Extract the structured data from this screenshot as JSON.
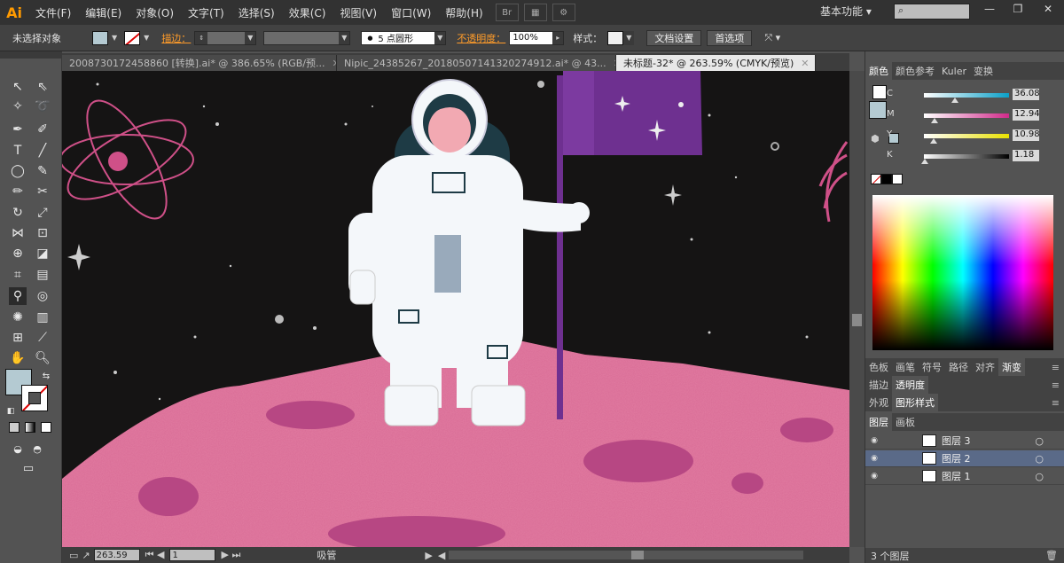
{
  "app": {
    "logo": "Ai"
  },
  "menu": [
    "文件(F)",
    "编辑(E)",
    "对象(O)",
    "文字(T)",
    "选择(S)",
    "效果(C)",
    "视图(V)",
    "窗口(W)",
    "帮助(H)"
  ],
  "menubar_icons": {
    "bridge": "Br",
    "arrange": "▦",
    "gpu": "⚙"
  },
  "workspace": "基本功能",
  "search_placeholder": "",
  "window_controls": {
    "minimize": "—",
    "restore": "❐",
    "close": "✕"
  },
  "control": {
    "selection": "未选择对象",
    "stroke_label": "描边：",
    "brush": "5 点圆形",
    "opacity_label": "不透明度：",
    "opacity": "100%",
    "style_label": "样式：",
    "doc_setup": "文档设置",
    "preferences": "首选项"
  },
  "tabs": [
    {
      "label": "2008730172458860 [转换].ai* @ 386.65% (RGB/预...",
      "close": "✕"
    },
    {
      "label": "Nipic_24385267_20180507141320274912.ai* @ 43...",
      "close": "✕"
    },
    {
      "label": "未标题-32* @ 263.59% (CMYK/预览)",
      "close": "✕"
    }
  ],
  "status": {
    "zoom": "263.59",
    "page": "1",
    "tool": "吸管"
  },
  "color_panel": {
    "tabs": [
      "颜色",
      "颜色参考",
      "Kuler",
      "变换"
    ],
    "sliders": [
      {
        "label": "C",
        "value": "36.08",
        "pct": 0.36
      },
      {
        "label": "M",
        "value": "12.94",
        "pct": 0.13
      },
      {
        "label": "Y",
        "value": "10.98",
        "pct": 0.11
      },
      {
        "label": "K",
        "value": "1.18",
        "pct": 0.01
      }
    ]
  },
  "panel_tabs_2": [
    "色板",
    "画笔",
    "符号",
    "路径",
    "对齐",
    "渐变"
  ],
  "panel_tabs_3": [
    "描边",
    "透明度"
  ],
  "panel_tabs_4": [
    "外观",
    "图形样式"
  ],
  "layers_panel": {
    "tabs": [
      "图层",
      "画板"
    ],
    "layers": [
      {
        "name": "图层 3"
      },
      {
        "name": "图层 2"
      },
      {
        "name": "图层 1"
      }
    ],
    "count": "3 个图层"
  },
  "colors": {
    "planet": "#e07aa0",
    "crater": "#b74783",
    "flag": "#6e3090",
    "suit": "#f4f7fa",
    "visor_ring": "#1e3b45",
    "helmet_face": "#f2a9b2",
    "fill_swatch": "#b4cad2"
  }
}
